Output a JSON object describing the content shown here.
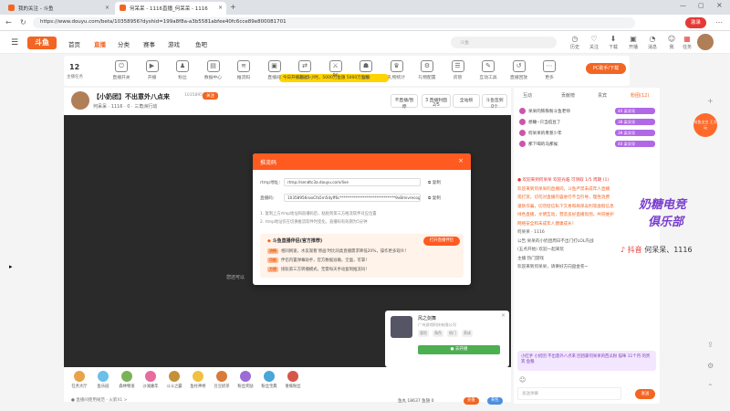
{
  "browser": {
    "tabs": [
      {
        "title": "我的关注 - 斗鱼",
        "active": false
      },
      {
        "title": "何呆呆 - 1116直播_何呆呆 - 1116",
        "active": true
      }
    ],
    "url": "https://www.douyu.com/beta/10358956?dyshid=199a8f8a-a3b5581abfee40fc6cce89e800081701",
    "profile": "激录"
  },
  "header": {
    "logo": "斗鱼",
    "nav": [
      "首页",
      "直播",
      "分类",
      "赛事",
      "游戏",
      "鱼吧"
    ],
    "search_placeholder": "斗鱼",
    "icons": [
      "历史",
      "关注",
      "下载",
      "开播",
      "消息",
      "我",
      "任务"
    ]
  },
  "categories": {
    "level_number": "12",
    "level_label": "主播任务",
    "items": [
      "直播开关",
      "开播",
      "粉丝",
      "数据中心",
      "推流码",
      "直播间",
      "联动",
      "PK",
      "公会",
      "礼物统计",
      "礼物配置",
      "房管",
      "互动工具",
      "直播回放",
      "更多"
    ],
    "promo": "今日开播超过1小时，5000万鱼翅 5000万鱼粮",
    "pc_button": "PC助手/下载"
  },
  "stream": {
    "title": "【小奶团】不出意外八点来",
    "follow": "关注",
    "room_id": "10358956",
    "host_line": "何呆呆 · 1116 · 0 · 三角洲行动",
    "buttons": [
      "不直播/暂停",
      "3 直播封面 2/5",
      "全站榜",
      "斗鱼签到 0个"
    ],
    "nosignal": "您还可以"
  },
  "modal": {
    "title": "推流码",
    "rtmp_label": "rtmp地址：",
    "rtmp_value": "rtmp://sendtc3a.douyu.com/live",
    "key_label": "直播码：",
    "key_value": "10358956rooCfa5m5dyff6c*****************************9vBmivrecognition",
    "copy": "复制",
    "tip1": "1. 复制上方rtmp地址和直播码后，粘贴到第三方推流软件对应位置",
    "tip2": "2. rtmp地址仅在切换推流软件时变化，直播码有效期为5分钟",
    "tool_title": "斗鱼直播伴侣(官方推荐)",
    "tool_button": "打开直播伴侣",
    "features": [
      {
        "tag": "流畅",
        "text": "相同网速，水友观看'原画'时比同类直播需求降低20%，操作更多观众！"
      },
      {
        "tag": "功能",
        "text": "伴侣内置弹幕助手，官方数据准确，全面，可靠！"
      },
      {
        "tag": "方便",
        "text": "接轨第三方转播模式，无需每天手动复制推流码！"
      }
    ]
  },
  "game_popup": {
    "name": "风之剑舞",
    "subtitle": "广州游戏科技有限公司",
    "tags": [
      "冒险",
      "角色",
      "热门",
      "养成"
    ],
    "button": "● 去开播",
    "close": "×"
  },
  "gifts": {
    "items": [
      "任务大厅",
      "鱼乐园",
      "森林物语",
      "沙滩嘉年",
      "斗斗之霸",
      "鱼柱神桥",
      "豆豆奶茶",
      "粉丝奖励",
      "粉丝宝典",
      "谁偷粉丝"
    ],
    "status": "● 直播间使用规范 - 火箭X1 >",
    "yuchi": "鱼丸 18637  鱼翅 0",
    "btn1": "充值",
    "btn2": "背包"
  },
  "right_panel": {
    "tabs": [
      "互动",
      "贡献榜",
      "贵宾",
      "粉团(12)"
    ],
    "rank": [
      {
        "name": "呆呆的铁铁粉斗鱼老师",
        "lv": "40 梁呆呆"
      },
      {
        "name": "想睡--只当痘豆了",
        "lv": "38 梁呆呆"
      },
      {
        "name": "何呆呆的青葱少年",
        "lv": "39 梁呆呆"
      },
      {
        "name": "那下喝的马那候",
        "lv": "40 梁呆呆"
      }
    ],
    "chat": [
      {
        "text": "● 欢迎来到何呆呆 欢迎光临 可领取 1/5 周期 (1)",
        "style": "red"
      },
      {
        "text": "欢迎来到何呆呆的直播间，斗鱼严禁未成年人直播",
        "style": "org"
      },
      {
        "text": "或打赏，切勿对直播内容进行不当引导，理性消费",
        "style": "org"
      },
      {
        "text": "谨防诈骗，切勿轻信私下交易和刷单返利等虚假信息",
        "style": "org"
      },
      {
        "text": "绿色直播，文明互动，营造良好直播氛围，共同维护",
        "style": "org"
      },
      {
        "text": "网络安全和未成年人健康成长！",
        "style": "org"
      },
      {
        "text": "何呆呆 · 1116",
        "style": ""
      },
      {
        "text": "公告  呆呆的小奶团周日不出门打LOL内战",
        "style": ""
      },
      {
        "text": "   (五点开始) 欢迎一起来玩",
        "style": ""
      },
      {
        "text": "主播  热门游戏",
        "style": ""
      },
      {
        "text": "欢迎来到何呆呆，请秉好方向盘金卷~",
        "style": ""
      }
    ],
    "fans_row": "小红手 小奶团 不出意外八点来 团团豪何呆呆的西瓜粉 猫咪 11个月 的贵宾 鱼粮",
    "input_placeholder": "发送弹幕",
    "send": "发送"
  },
  "overlay": {
    "wm_line1": "奶糖电竞",
    "wm_line2": "俱乐部",
    "tiktok_brand": "抖音",
    "tiktok_name": "何呆呆、1116",
    "badge": "抖鱼太空\n王大玩"
  }
}
